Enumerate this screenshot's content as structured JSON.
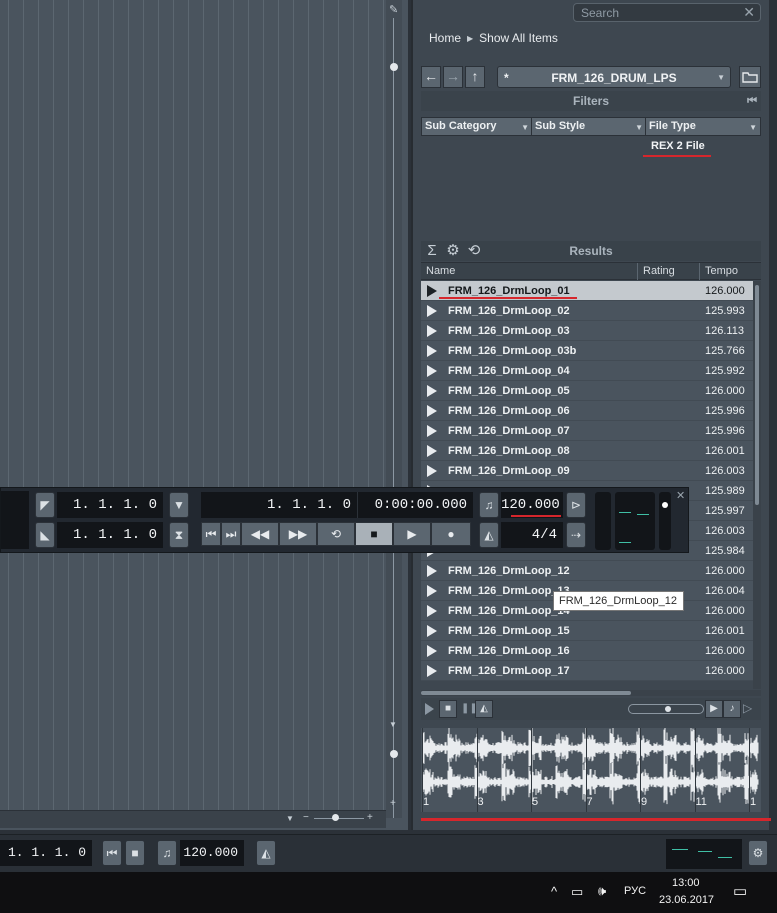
{
  "search": {
    "placeholder": "Search"
  },
  "breadcrumb": {
    "home": "Home",
    "current": "Show All Items"
  },
  "path": {
    "star": "*",
    "name": "FRM_126_DRUM_LPS"
  },
  "filters": {
    "title": "Filters",
    "columns": [
      "Sub Category",
      "Sub Style",
      "File Type"
    ],
    "selected_file_type": "REX 2 File"
  },
  "results": {
    "title": "Results",
    "columns": {
      "name": "Name",
      "rating": "Rating",
      "tempo": "Tempo"
    },
    "rows": [
      {
        "name": "FRM_126_DrmLoop_01",
        "tempo": "126.000",
        "selected": true
      },
      {
        "name": "FRM_126_DrmLoop_02",
        "tempo": "125.993"
      },
      {
        "name": "FRM_126_DrmLoop_03",
        "tempo": "126.113"
      },
      {
        "name": "FRM_126_DrmLoop_03b",
        "tempo": "125.766"
      },
      {
        "name": "FRM_126_DrmLoop_04",
        "tempo": "125.992"
      },
      {
        "name": "FRM_126_DrmLoop_05",
        "tempo": "126.000"
      },
      {
        "name": "FRM_126_DrmLoop_06",
        "tempo": "125.996"
      },
      {
        "name": "FRM_126_DrmLoop_07",
        "tempo": "125.996"
      },
      {
        "name": "FRM_126_DrmLoop_08",
        "tempo": "126.001"
      },
      {
        "name": "FRM_126_DrmLoop_09",
        "tempo": "126.003"
      },
      {
        "name": "",
        "tempo": "125.989"
      },
      {
        "name": "",
        "tempo": "125.997"
      },
      {
        "name": "",
        "tempo": "126.003"
      },
      {
        "name": "",
        "tempo": "125.984"
      },
      {
        "name": "FRM_126_DrmLoop_12",
        "tempo": "126.000"
      },
      {
        "name": "FRM_126_DrmLoop_13",
        "tempo": "126.004"
      },
      {
        "name": "FRM_126_DrmLoop_14",
        "tempo": "126.000"
      },
      {
        "name": "FRM_126_DrmLoop_15",
        "tempo": "126.001"
      },
      {
        "name": "FRM_126_DrmLoop_16",
        "tempo": "126.000"
      },
      {
        "name": "FRM_126_DrmLoop_17",
        "tempo": "126.000"
      }
    ]
  },
  "tooltip": {
    "text": "FRM_126_DrmLoop_12"
  },
  "waveform": {
    "markers": [
      "1",
      "3",
      "5",
      "7",
      "9",
      "11",
      "1"
    ]
  },
  "transport": {
    "left_locator": "1. 1. 1.   0",
    "right_locator": "1. 1. 1.   0",
    "position_bars": "1. 1. 1.   0",
    "position_time": "0:00:00.000",
    "tempo": "120.000",
    "signature": "4/4"
  },
  "statusbar": {
    "position": "1. 1. 1.   0",
    "tempo": "120.000"
  },
  "taskbar": {
    "lang": "РУС",
    "time": "13:00",
    "date": "23.06.2017"
  },
  "colors": {
    "accent_red": "#d6262c",
    "panel": "#3e4750",
    "row": "#4a545e",
    "selected_row": "#c4c9ce"
  }
}
